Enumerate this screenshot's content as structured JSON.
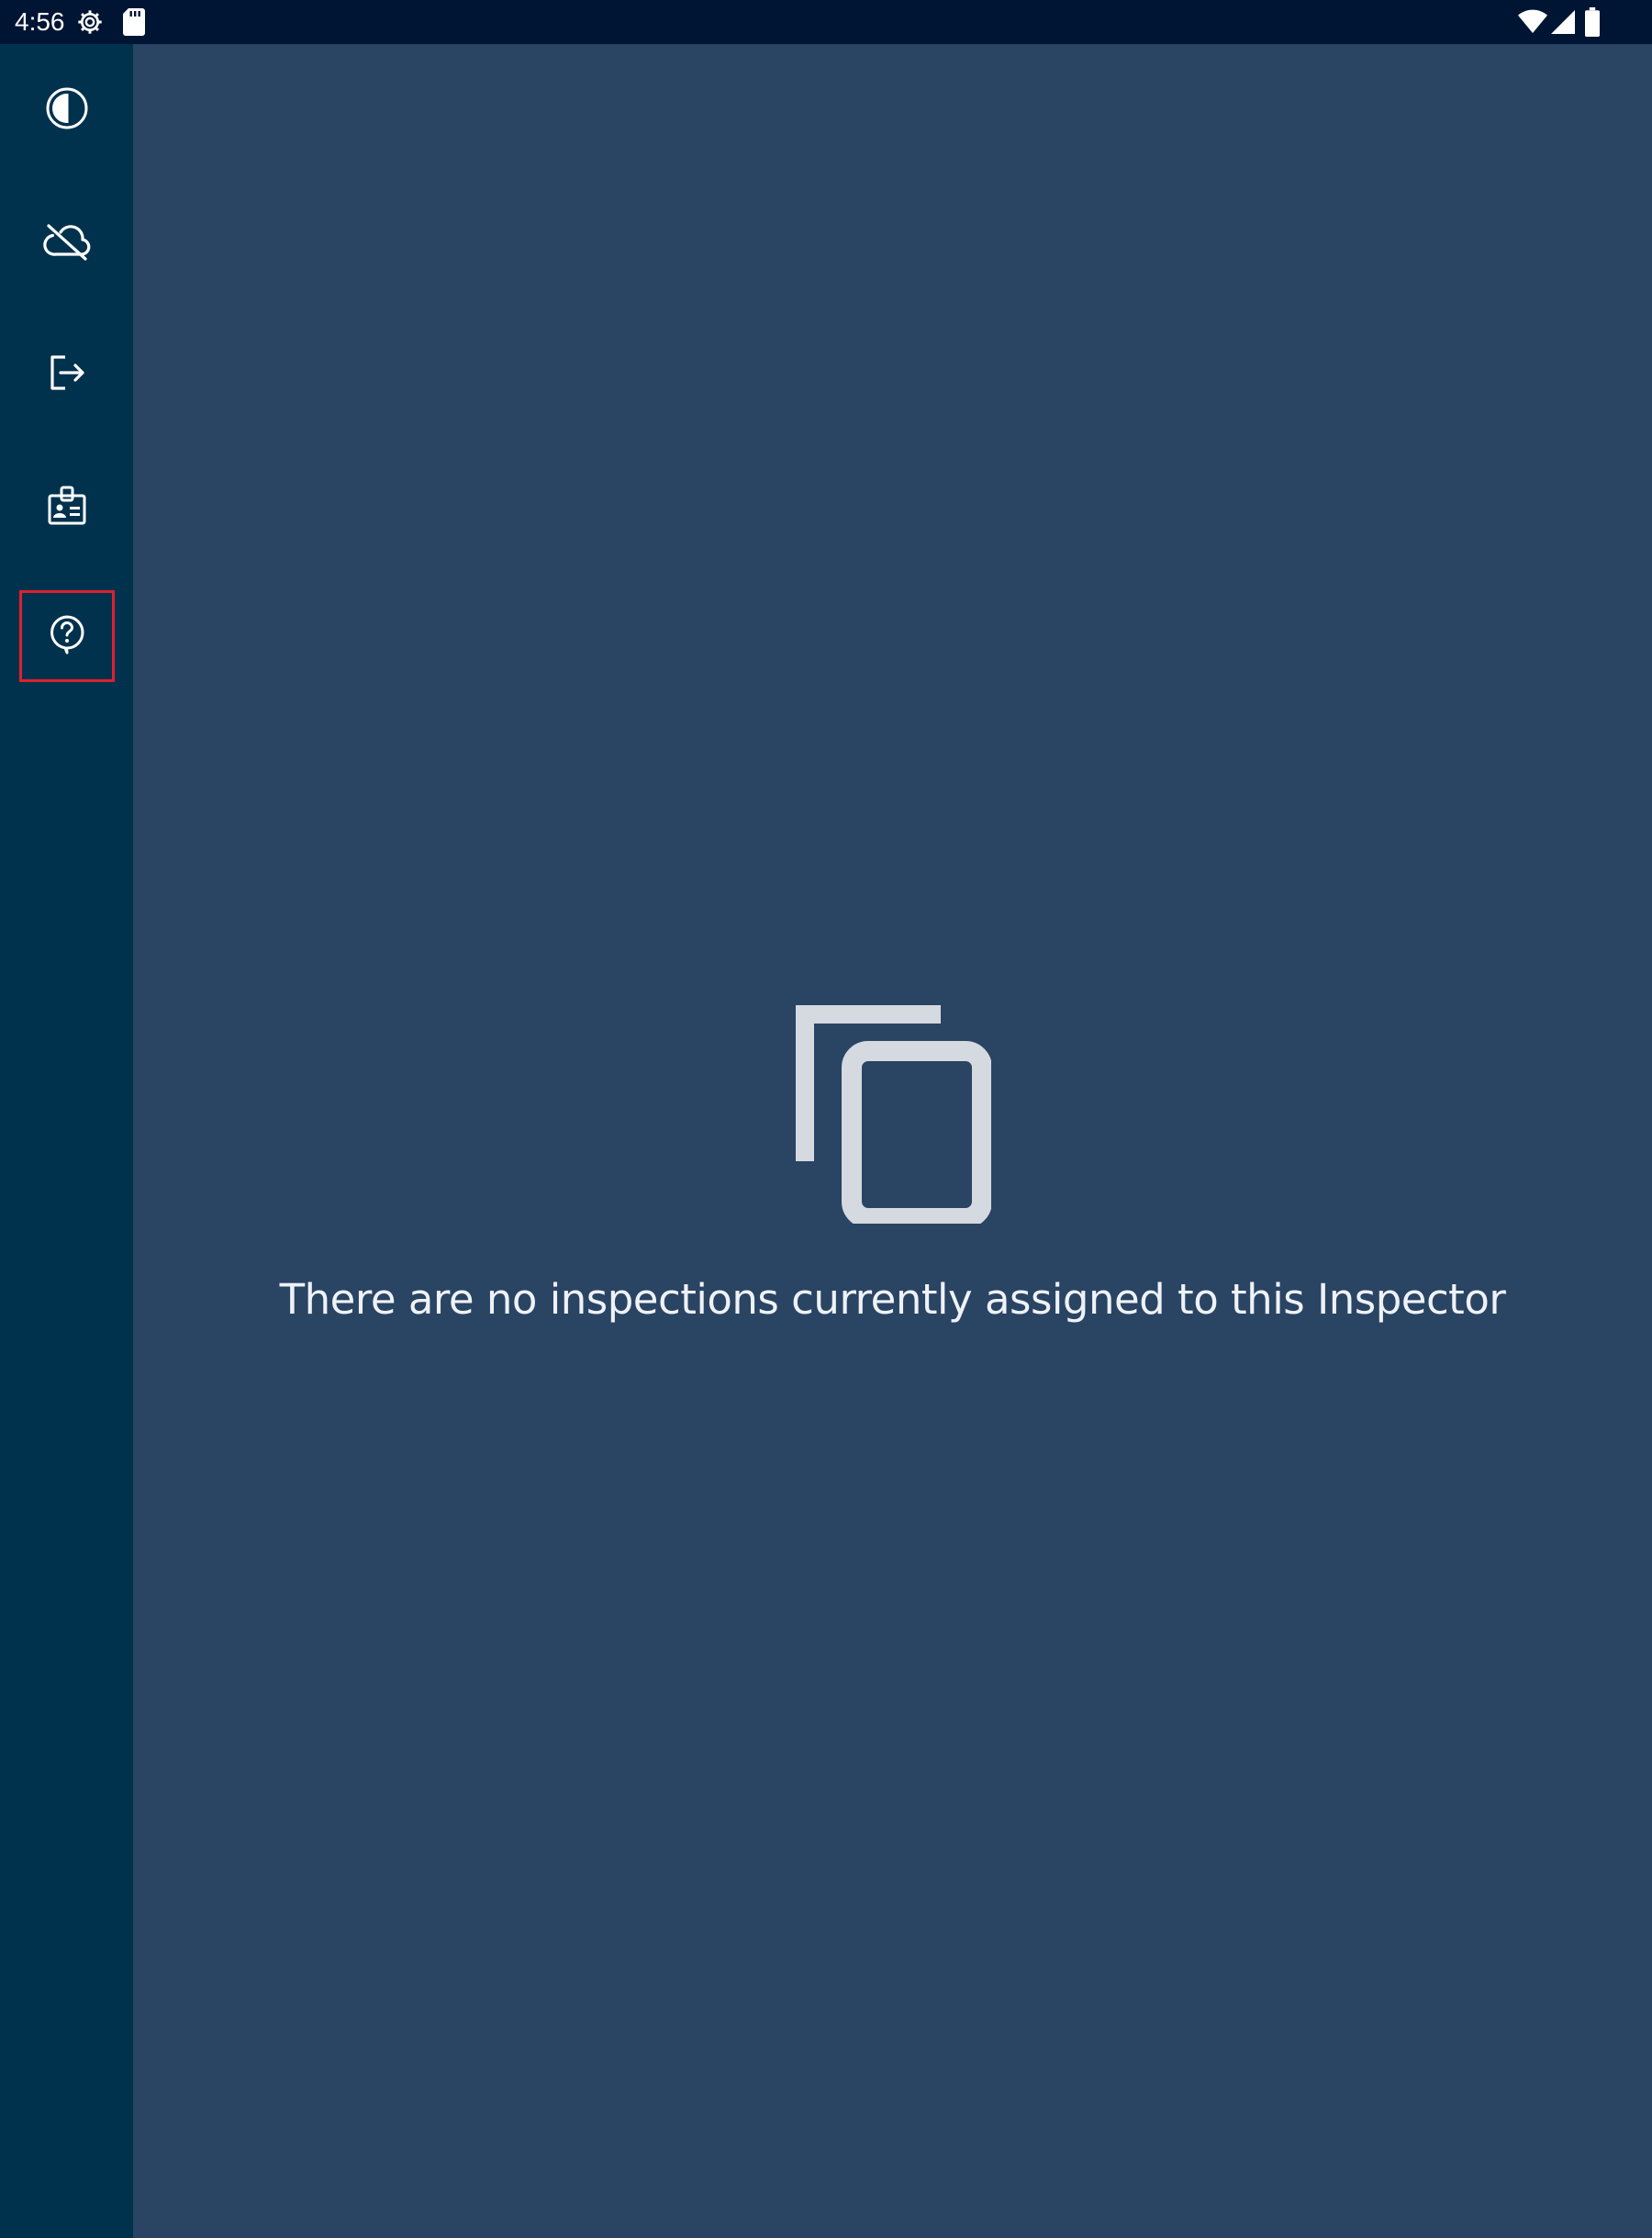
{
  "status_bar": {
    "time": "4:56",
    "icons": [
      "settings-gear-icon",
      "sd-card-icon",
      "wifi-icon",
      "cellular-signal-icon",
      "battery-icon"
    ]
  },
  "sidebar": {
    "items": [
      {
        "name": "theme-contrast",
        "icon": "contrast-icon"
      },
      {
        "name": "sync-offline",
        "icon": "cloud-off-icon"
      },
      {
        "name": "logout",
        "icon": "logout-icon"
      },
      {
        "name": "inspector-badge",
        "icon": "id-badge-icon"
      },
      {
        "name": "help",
        "icon": "help-circle-icon",
        "active": true
      }
    ]
  },
  "main": {
    "empty_state": {
      "icon": "copy-documents-icon",
      "message": "There are no inspections currently assigned to this Inspector"
    }
  },
  "colors": {
    "status_bar_bg": "#001533",
    "sidebar_bg": "#00324d",
    "main_bg": "#2a4463",
    "active_outline": "#e0202e",
    "icon_color": "#ffffff",
    "empty_icon_color": "#d5d9e0"
  }
}
